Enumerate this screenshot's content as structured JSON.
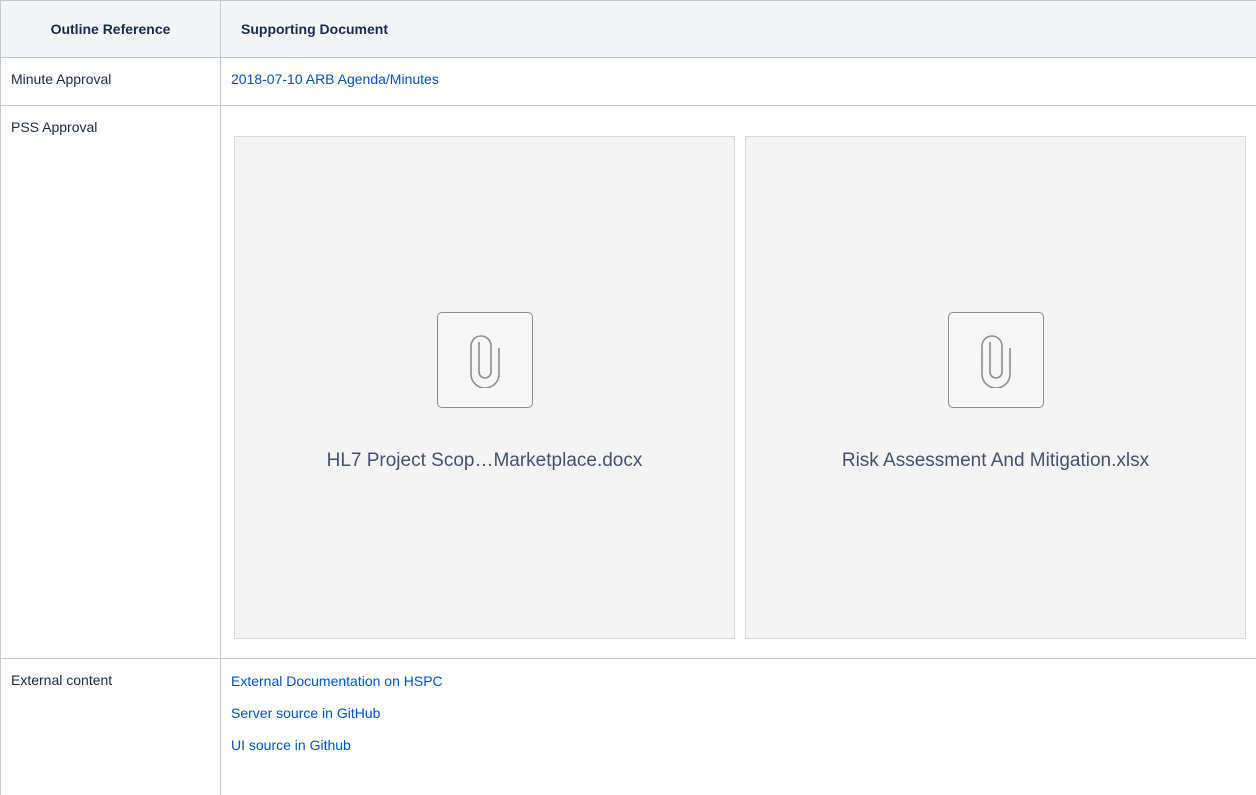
{
  "table": {
    "headers": {
      "col1": "Outline Reference",
      "col2": "Supporting Document"
    },
    "rows": {
      "minute": {
        "label": "Minute Approval",
        "link": "2018-07-10 ARB Agenda/Minutes"
      },
      "pss": {
        "label": "PSS Approval",
        "attachments": [
          {
            "filename": "HL7 Project Scop…Marketplace.docx",
            "icon": "paperclip-icon"
          },
          {
            "filename": "Risk Assessment And Mitigation.xlsx",
            "icon": "paperclip-icon"
          }
        ]
      },
      "external": {
        "label": "External content",
        "links": [
          "External Documentation on HSPC",
          "Server source in GitHub",
          "UI source in Github"
        ]
      }
    }
  },
  "colors": {
    "link": "#0052cc",
    "header_bg": "#f4f5f7",
    "border": "#c1c7d0",
    "card_bg": "#f4f4f4"
  }
}
